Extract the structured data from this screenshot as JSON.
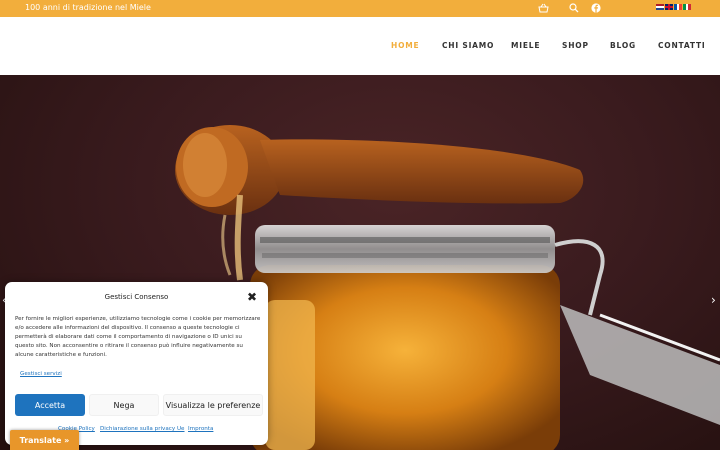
{
  "topbar": {
    "tagline": "100 anni di tradizione nel Miele",
    "background": "#f2ae3c",
    "icons": [
      "basket-icon",
      "search-icon",
      "facebook-icon"
    ],
    "languages": [
      "nl",
      "en",
      "fr",
      "it"
    ]
  },
  "nav": {
    "items": [
      {
        "label": "HOME",
        "active": true
      },
      {
        "label": "CHI SIAMO",
        "active": false
      },
      {
        "label": "MIELE",
        "active": false
      },
      {
        "label": "SHOP",
        "active": false
      },
      {
        "label": "BLOG",
        "active": false
      },
      {
        "label": "CONTATTI",
        "active": false
      }
    ],
    "active_color": "#f2ae3c"
  },
  "hero": {
    "description_icon": "honey-jar-with-dipper-photo",
    "prev_arrow": "‹",
    "next_arrow": "›"
  },
  "consent": {
    "title": "Gestisci Consenso",
    "close": "✖",
    "body": "Per fornire le migliori esperienze, utilizziamo tecnologie come i cookie per memorizzare e/o accedere alle informazioni del dispositivo. Il consenso a queste tecnologie ci permetterà di elaborare dati come il comportamento di navigazione o ID unici su questo sito. Non acconsentire o ritirare il consenso può influire negativamente su alcune caratteristiche e funzioni.",
    "manage_link": "Gestisci servizi",
    "accept": "Accetta",
    "deny": "Nega",
    "preferences": "Visualizza le preferenze",
    "footer_links": [
      "Cookie Policy",
      "Dichiarazione sulla privacy Ue",
      "Impronta"
    ],
    "accent": "#1e73be"
  },
  "translate": {
    "label": "Translate »"
  }
}
